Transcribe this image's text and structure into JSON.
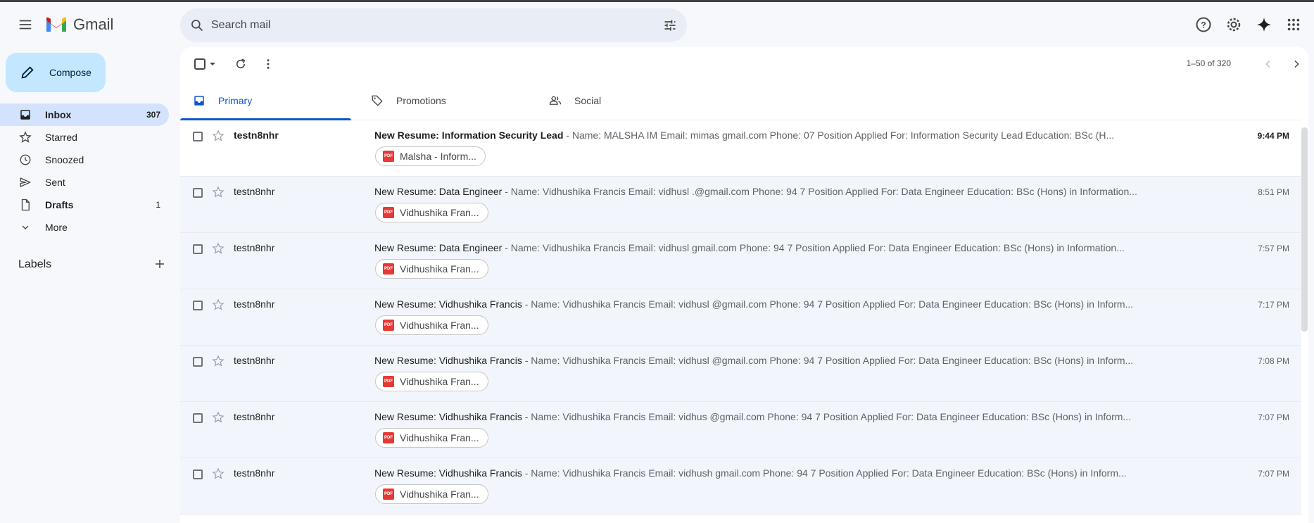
{
  "app": {
    "name": "Gmail"
  },
  "search": {
    "placeholder": "Search mail"
  },
  "compose": {
    "label": "Compose"
  },
  "sidebar": {
    "items": [
      {
        "label": "Inbox",
        "count": "307",
        "icon": "inbox-icon"
      },
      {
        "label": "Starred",
        "count": "",
        "icon": "star-icon"
      },
      {
        "label": "Snoozed",
        "count": "",
        "icon": "clock-icon"
      },
      {
        "label": "Sent",
        "count": "",
        "icon": "send-icon"
      },
      {
        "label": "Drafts",
        "count": "1",
        "icon": "draft-icon"
      },
      {
        "label": "More",
        "count": "",
        "icon": "chevron-down-icon"
      }
    ],
    "labels_title": "Labels"
  },
  "toolbar": {
    "pager": "1–50 of 320"
  },
  "tabs": [
    {
      "label": "Primary",
      "icon": "inbox-icon"
    },
    {
      "label": "Promotions",
      "icon": "tag-icon"
    },
    {
      "label": "Social",
      "icon": "people-icon"
    }
  ],
  "emails": [
    {
      "sender": "testn8nhr",
      "subject": "New Resume: Information Security Lead",
      "snippet": " - Name: MALSHA IM          Email: mimas         gmail.com Phone: 07                   Position Applied For: Information Security Lead Education: BSc (H...",
      "time": "9:44 PM",
      "attachment": "Malsha - Inform..."
    },
    {
      "sender": "testn8nhr",
      "subject": "New Resume: Data Engineer",
      "snippet": " - Name: Vidhushika Francis Email: vidhusl           .@gmail.com Phone: 94 7            Position Applied For: Data Engineer Education: BSc (Hons) in Information...",
      "time": "8:51 PM",
      "attachment": "Vidhushika Fran..."
    },
    {
      "sender": "testn8nhr",
      "subject": "New Resume: Data Engineer",
      "snippet": " - Name: Vidhushika Francis Email: vidhusl         gmail.com Phone: 94 7           Position Applied For: Data Engineer Education: BSc (Hons) in Information...",
      "time": "7:57 PM",
      "attachment": "Vidhushika Fran..."
    },
    {
      "sender": "testn8nhr",
      "subject": "New Resume: Vidhushika Francis",
      "snippet": " - Name: Vidhushika Francis Email: vidhusl          @gmail.com Phone: 94 7           Position Applied For: Data Engineer Education: BSc (Hons) in Inform...",
      "time": "7:17 PM",
      "attachment": "Vidhushika Fran..."
    },
    {
      "sender": "testn8nhr",
      "subject": "New Resume: Vidhushika Francis",
      "snippet": " - Name: Vidhushika Francis Email: vidhusl          @gmail.com Phone: 94 7         Position Applied For: Data Engineer Education: BSc (Hons) in Inform...",
      "time": "7:08 PM",
      "attachment": "Vidhushika Fran..."
    },
    {
      "sender": "testn8nhr",
      "subject": "New Resume: Vidhushika Francis",
      "snippet": " - Name: Vidhushika Francis Email: vidhus          @gmail.com Phone: 94 7          Position Applied For: Data Engineer Education: BSc (Hons) in Inform...",
      "time": "7:07 PM",
      "attachment": "Vidhushika Fran..."
    },
    {
      "sender": "testn8nhr",
      "subject": "New Resume: Vidhushika Francis",
      "snippet": " - Name: Vidhushika Francis Email: vidhush         gmail.com Phone: 94 7          Position Applied For: Data Engineer Education: BSc (Hons) in Inform...",
      "time": "7:07 PM",
      "attachment": "Vidhushika Fran..."
    }
  ],
  "colors": {
    "accent": "#0b57d0",
    "compose_bg": "#c2e7ff",
    "active_nav": "#d3e3fd",
    "pdf_red": "#e53935"
  }
}
